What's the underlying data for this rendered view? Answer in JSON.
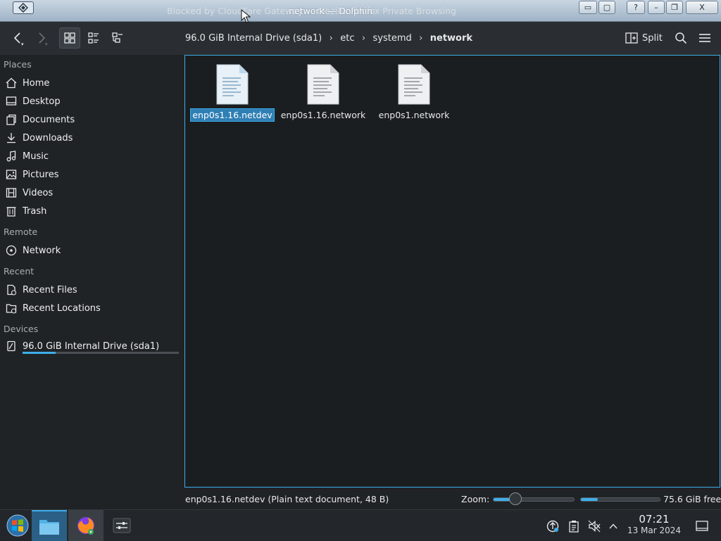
{
  "window": {
    "ghost_title": "Blocked by CloudFare Gateway — Mozilla Firefox Private Browsing",
    "title": "network — Dolphin",
    "help_label": "?",
    "minimize_label": "–",
    "maximize_label": "❐",
    "close_label": "X"
  },
  "toolbar": {
    "split_label": "Split"
  },
  "breadcrumb": {
    "items": [
      "96.0 GiB Internal Drive (sda1)",
      "etc",
      "systemd"
    ],
    "current": "network"
  },
  "sidebar": {
    "places_title": "Places",
    "places": [
      {
        "label": "Home",
        "icon": "home-icon"
      },
      {
        "label": "Desktop",
        "icon": "desktop-icon"
      },
      {
        "label": "Documents",
        "icon": "documents-icon"
      },
      {
        "label": "Downloads",
        "icon": "downloads-icon"
      },
      {
        "label": "Music",
        "icon": "music-icon"
      },
      {
        "label": "Pictures",
        "icon": "pictures-icon"
      },
      {
        "label": "Videos",
        "icon": "videos-icon"
      },
      {
        "label": "Trash",
        "icon": "trash-icon"
      }
    ],
    "remote_title": "Remote",
    "remote": [
      {
        "label": "Network",
        "icon": "network-icon"
      }
    ],
    "recent_title": "Recent",
    "recent": [
      {
        "label": "Recent Files",
        "icon": "recent-files-icon"
      },
      {
        "label": "Recent Locations",
        "icon": "recent-locations-icon"
      }
    ],
    "devices_title": "Devices",
    "devices": [
      {
        "label": "96.0 GiB Internal Drive (sda1)",
        "icon": "drive-icon",
        "usage_fraction": 0.21
      }
    ]
  },
  "files": [
    {
      "name": "enp0s1.16.netdev",
      "selected": true
    },
    {
      "name": "enp0s1.16.network",
      "selected": false
    },
    {
      "name": "enp0s1.network",
      "selected": false
    }
  ],
  "status": {
    "selection_text": "enp0s1.16.netdev (Plain text document, 48 B)",
    "zoom_label": "Zoom:",
    "zoom_fraction": 0.28,
    "free_text": "75.6 GiB free",
    "free_used_fraction": 0.21
  },
  "taskbar": {
    "time": "07:21",
    "date": "13 Mar 2024"
  },
  "colors": {
    "accent": "#3daee9",
    "background": "#202326",
    "view_background": "#1b1e20"
  }
}
